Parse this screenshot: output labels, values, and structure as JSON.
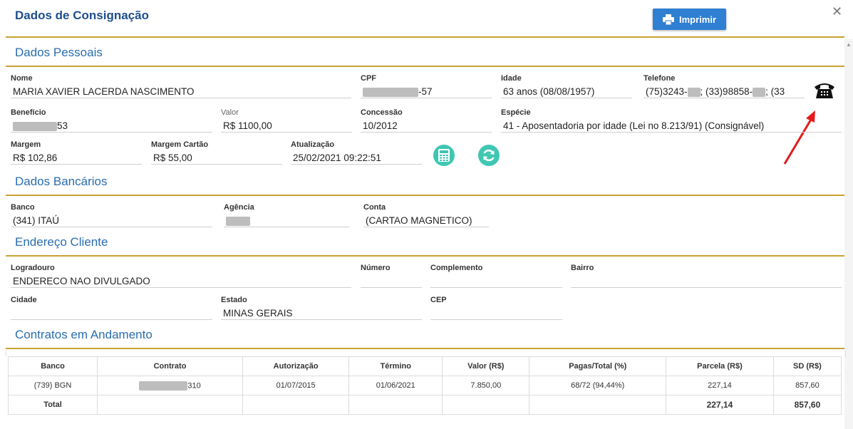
{
  "header": {
    "title": "Dados de Consignação",
    "print_label": "Imprimir"
  },
  "sections": {
    "personal": "Dados Pessoais",
    "bank": "Dados Bancários",
    "address": "Endereço Cliente",
    "contracts": "Contratos em Andamento"
  },
  "personal": {
    "nome_label": "Nome",
    "nome": "MARIA XAVIER LACERDA NASCIMENTO",
    "cpf_label": "CPF",
    "cpf_suffix": "-57",
    "idade_label": "Idade",
    "idade": "63 anos (08/08/1957)",
    "telefone_label": "Telefone",
    "tel_a": "(75)3243-",
    "tel_b": "; (33)98858-",
    "tel_c": "; (33",
    "beneficio_label": "Benefício",
    "beneficio_suffix": "53",
    "valor_label": "Valor",
    "valor": "R$ 1100,00",
    "concessao_label": "Concessão",
    "concessao": "10/2012",
    "especie_label": "Espécie",
    "especie": "41 - Aposentadoria por idade (Lei no 8.213/91) (Consignável)",
    "margem_label": "Margem",
    "margem": "R$ 102,86",
    "margem_cartao_label": "Margem Cartão",
    "margem_cartao": "R$ 55,00",
    "atualizacao_label": "Atualização",
    "atualizacao": "25/02/2021 09:22:51"
  },
  "bank": {
    "banco_label": "Banco",
    "banco": "(341) ITAÚ",
    "agencia_label": "Agência",
    "conta_label": "Conta",
    "conta": "(CARTAO MAGNETICO)"
  },
  "address": {
    "logradouro_label": "Logradouro",
    "logradouro": "ENDERECO NAO DIVULGADO",
    "numero_label": "Número",
    "numero": "",
    "complemento_label": "Complemento",
    "complemento": "",
    "bairro_label": "Bairro",
    "bairro": "",
    "cidade_label": "Cidade",
    "cidade": "",
    "estado_label": "Estado",
    "estado": "MINAS GERAIS",
    "cep_label": "CEP",
    "cep": ""
  },
  "contracts": {
    "headers": [
      "Banco",
      "Contrato",
      "Autorização",
      "Término",
      "Valor (R$)",
      "Pagas/Total (%)",
      "Parcela (R$)",
      "SD (R$)"
    ],
    "row": {
      "banco": "(739) BGN",
      "contrato_suffix": "310",
      "autorizacao": "01/07/2015",
      "termino": "01/06/2021",
      "valor": "7.850,00",
      "pagas": "68/72 (94,44%)",
      "parcela": "227,14",
      "sd": "857,60"
    },
    "total": {
      "label": "Total",
      "parcela": "227,14",
      "sd": "857,60"
    }
  },
  "icons": {
    "print": "printer-icon",
    "close": "close-icon",
    "phone": "telephone-icon",
    "calc": "calculator-icon",
    "refresh": "refresh-icon",
    "arrow": "red-arrow"
  },
  "colors": {
    "title": "#1f4e8c",
    "section": "#2a6db0",
    "rule": "#c9a233",
    "button": "#2f7fd3",
    "accent": "#3fc7b3",
    "arrow": "#e31b1b"
  }
}
